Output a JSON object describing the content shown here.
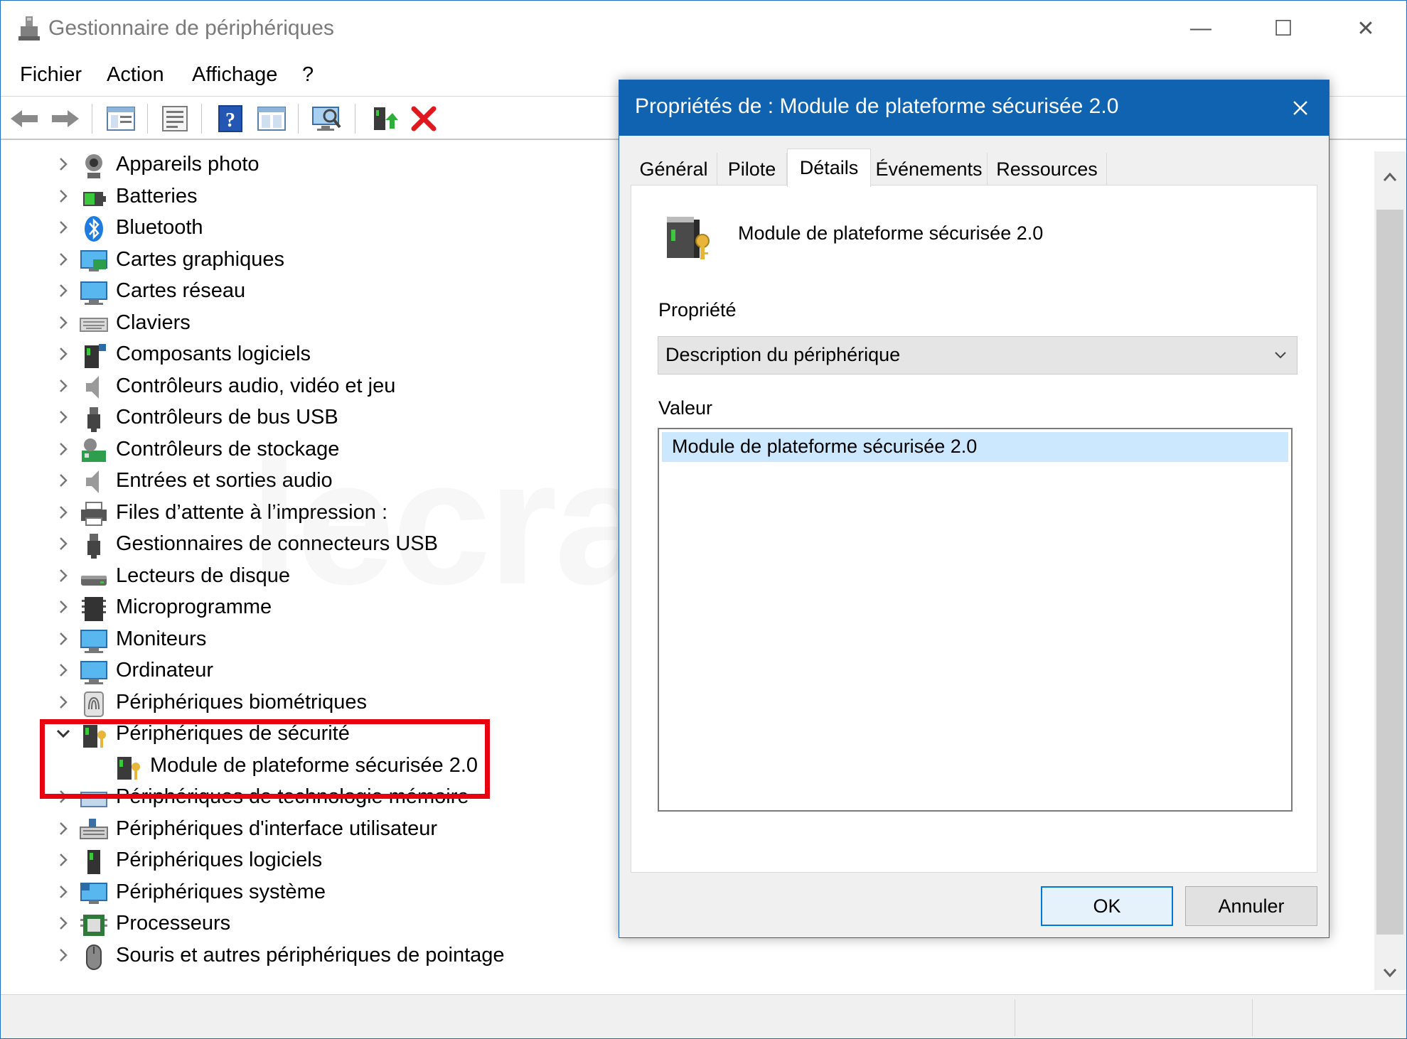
{
  "window": {
    "title": "Gestionnaire de périphériques",
    "controls": {
      "minimize": "—",
      "maximize": "☐",
      "close": "✕"
    }
  },
  "menu": [
    "Fichier",
    "Action",
    "Affichage",
    "?"
  ],
  "toolbar": {
    "buttons": [
      "back-icon",
      "forward-icon",
      "show-hide-tree-icon",
      "properties-icon",
      "help-icon",
      "action-view-icon",
      "scan-hardware-icon",
      "update-driver-icon",
      "uninstall-icon"
    ]
  },
  "tree": {
    "items": [
      {
        "label": "Appareils photo",
        "icon": "camera-icon"
      },
      {
        "label": "Batteries",
        "icon": "battery-icon"
      },
      {
        "label": "Bluetooth",
        "icon": "bluetooth-icon"
      },
      {
        "label": "Cartes graphiques",
        "icon": "display-adapter-icon"
      },
      {
        "label": "Cartes réseau",
        "icon": "network-adapter-icon"
      },
      {
        "label": "Claviers",
        "icon": "keyboard-icon"
      },
      {
        "label": "Composants logiciels",
        "icon": "software-component-icon"
      },
      {
        "label": "Contrôleurs audio, vidéo et jeu",
        "icon": "speaker-icon"
      },
      {
        "label": "Contrôleurs de bus USB",
        "icon": "usb-icon"
      },
      {
        "label": "Contrôleurs de stockage",
        "icon": "storage-controller-icon"
      },
      {
        "label": "Entrées et sorties audio",
        "icon": "audio-io-icon"
      },
      {
        "label": "Files d’attente à l’impression :",
        "icon": "printer-icon"
      },
      {
        "label": "Gestionnaires de connecteurs USB",
        "icon": "usb-connector-icon"
      },
      {
        "label": "Lecteurs de disque",
        "icon": "disk-drive-icon"
      },
      {
        "label": "Microprogramme",
        "icon": "firmware-icon"
      },
      {
        "label": "Moniteurs",
        "icon": "monitor-icon"
      },
      {
        "label": "Ordinateur",
        "icon": "computer-icon"
      },
      {
        "label": "Périphériques biométriques",
        "icon": "fingerprint-icon"
      },
      {
        "label": "Périphériques de sécurité",
        "icon": "security-device-icon",
        "expanded": true
      },
      {
        "label": "Module de plateforme sécurisée 2.0",
        "icon": "tpm-icon",
        "child": true
      },
      {
        "label": "Périphériques de technologie mémoire",
        "icon": "memory-device-icon"
      },
      {
        "label": "Périphériques d'interface utilisateur",
        "icon": "hid-icon"
      },
      {
        "label": "Périphériques logiciels",
        "icon": "software-device-icon"
      },
      {
        "label": "Périphériques système",
        "icon": "system-device-icon"
      },
      {
        "label": "Processeurs",
        "icon": "processor-icon"
      },
      {
        "label": "Souris et autres périphériques de pointage",
        "icon": "mouse-icon"
      }
    ]
  },
  "watermark": "lecrabeinfo",
  "dialog": {
    "title": "Propriétés de : Module de plateforme sécurisée 2.0",
    "tabs": [
      "Général",
      "Pilote",
      "Détails",
      "Événements",
      "Ressources"
    ],
    "active_tab": "Détails",
    "device_name": "Module de plateforme sécurisée 2.0",
    "property_label": "Propriété",
    "property_selected": "Description du périphérique",
    "value_label": "Valeur",
    "value_selected": "Module de plateforme sécurisée 2.0",
    "ok_label": "OK",
    "cancel_label": "Annuler"
  },
  "colors": {
    "dialog_title_bg": "#0f63b0",
    "selection_bg": "#cce8ff",
    "highlight_border": "#e8000e"
  }
}
